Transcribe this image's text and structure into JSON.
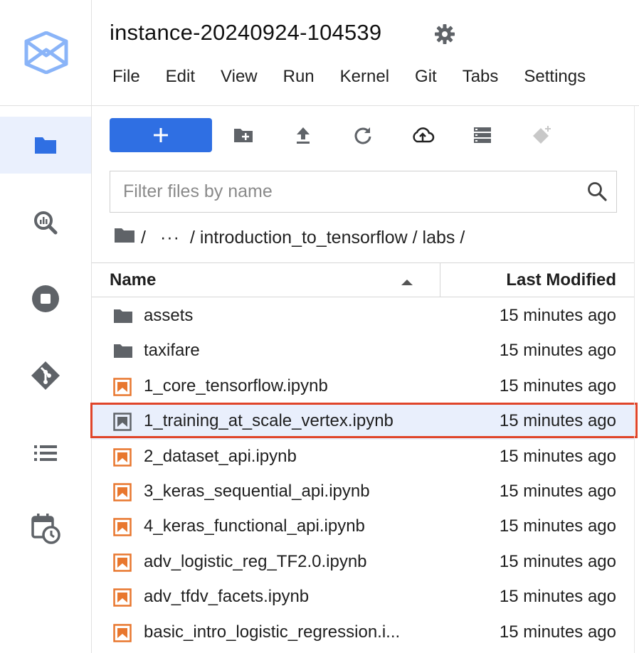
{
  "window": {
    "title": "instance-20240924-104539"
  },
  "menu": [
    "File",
    "Edit",
    "View",
    "Run",
    "Kernel",
    "Git",
    "Tabs",
    "Settings"
  ],
  "activity_bar": {
    "items": [
      {
        "name": "file-browser",
        "icon": "folder-icon",
        "active": true
      },
      {
        "name": "bigquery",
        "icon": "bigquery-search-icon",
        "active": false
      },
      {
        "name": "running",
        "icon": "stop-circle-icon",
        "active": false
      },
      {
        "name": "git",
        "icon": "git-icon",
        "active": false
      },
      {
        "name": "table-of-contents",
        "icon": "list-icon",
        "active": false
      },
      {
        "name": "scheduler",
        "icon": "calendar-clock-icon",
        "active": false
      }
    ]
  },
  "toolbar": {
    "new_label": "+",
    "tools": [
      "new-folder-icon",
      "upload-icon",
      "refresh-icon",
      "cloud-upload-icon",
      "storage-icon",
      "git-clone-icon"
    ]
  },
  "filter": {
    "placeholder": "Filter files by name",
    "value": ""
  },
  "breadcrumb": {
    "root_sep": "/",
    "ellipsis": "···",
    "path": "/ introduction_to_tensorflow / labs /"
  },
  "listing": {
    "col_name": "Name",
    "col_modified": "Last Modified",
    "rows": [
      {
        "name": "assets",
        "type": "folder",
        "modified": "15 minutes ago"
      },
      {
        "name": "taxifare",
        "type": "folder",
        "modified": "15 minutes ago"
      },
      {
        "name": "1_core_tensorflow.ipynb",
        "type": "notebook",
        "modified": "15 minutes ago"
      },
      {
        "name": "1_training_at_scale_vertex.ipynb",
        "type": "notebook",
        "modified": "15 minutes ago",
        "selected": true
      },
      {
        "name": "2_dataset_api.ipynb",
        "type": "notebook",
        "modified": "15 minutes ago"
      },
      {
        "name": "3_keras_sequential_api.ipynb",
        "type": "notebook",
        "modified": "15 minutes ago"
      },
      {
        "name": "4_keras_functional_api.ipynb",
        "type": "notebook",
        "modified": "15 minutes ago"
      },
      {
        "name": "adv_logistic_reg_TF2.0.ipynb",
        "type": "notebook",
        "modified": "15 minutes ago"
      },
      {
        "name": "adv_tfdv_facets.ipynb",
        "type": "notebook",
        "modified": "15 minutes ago"
      },
      {
        "name": "basic_intro_logistic_regression.i...",
        "type": "notebook",
        "modified": "15 minutes ago"
      }
    ]
  },
  "colors": {
    "accent": "#2f6fe3",
    "notebook_icon": "#e8772e",
    "selected_row": "#e9effc",
    "highlight": "#e0452a"
  }
}
